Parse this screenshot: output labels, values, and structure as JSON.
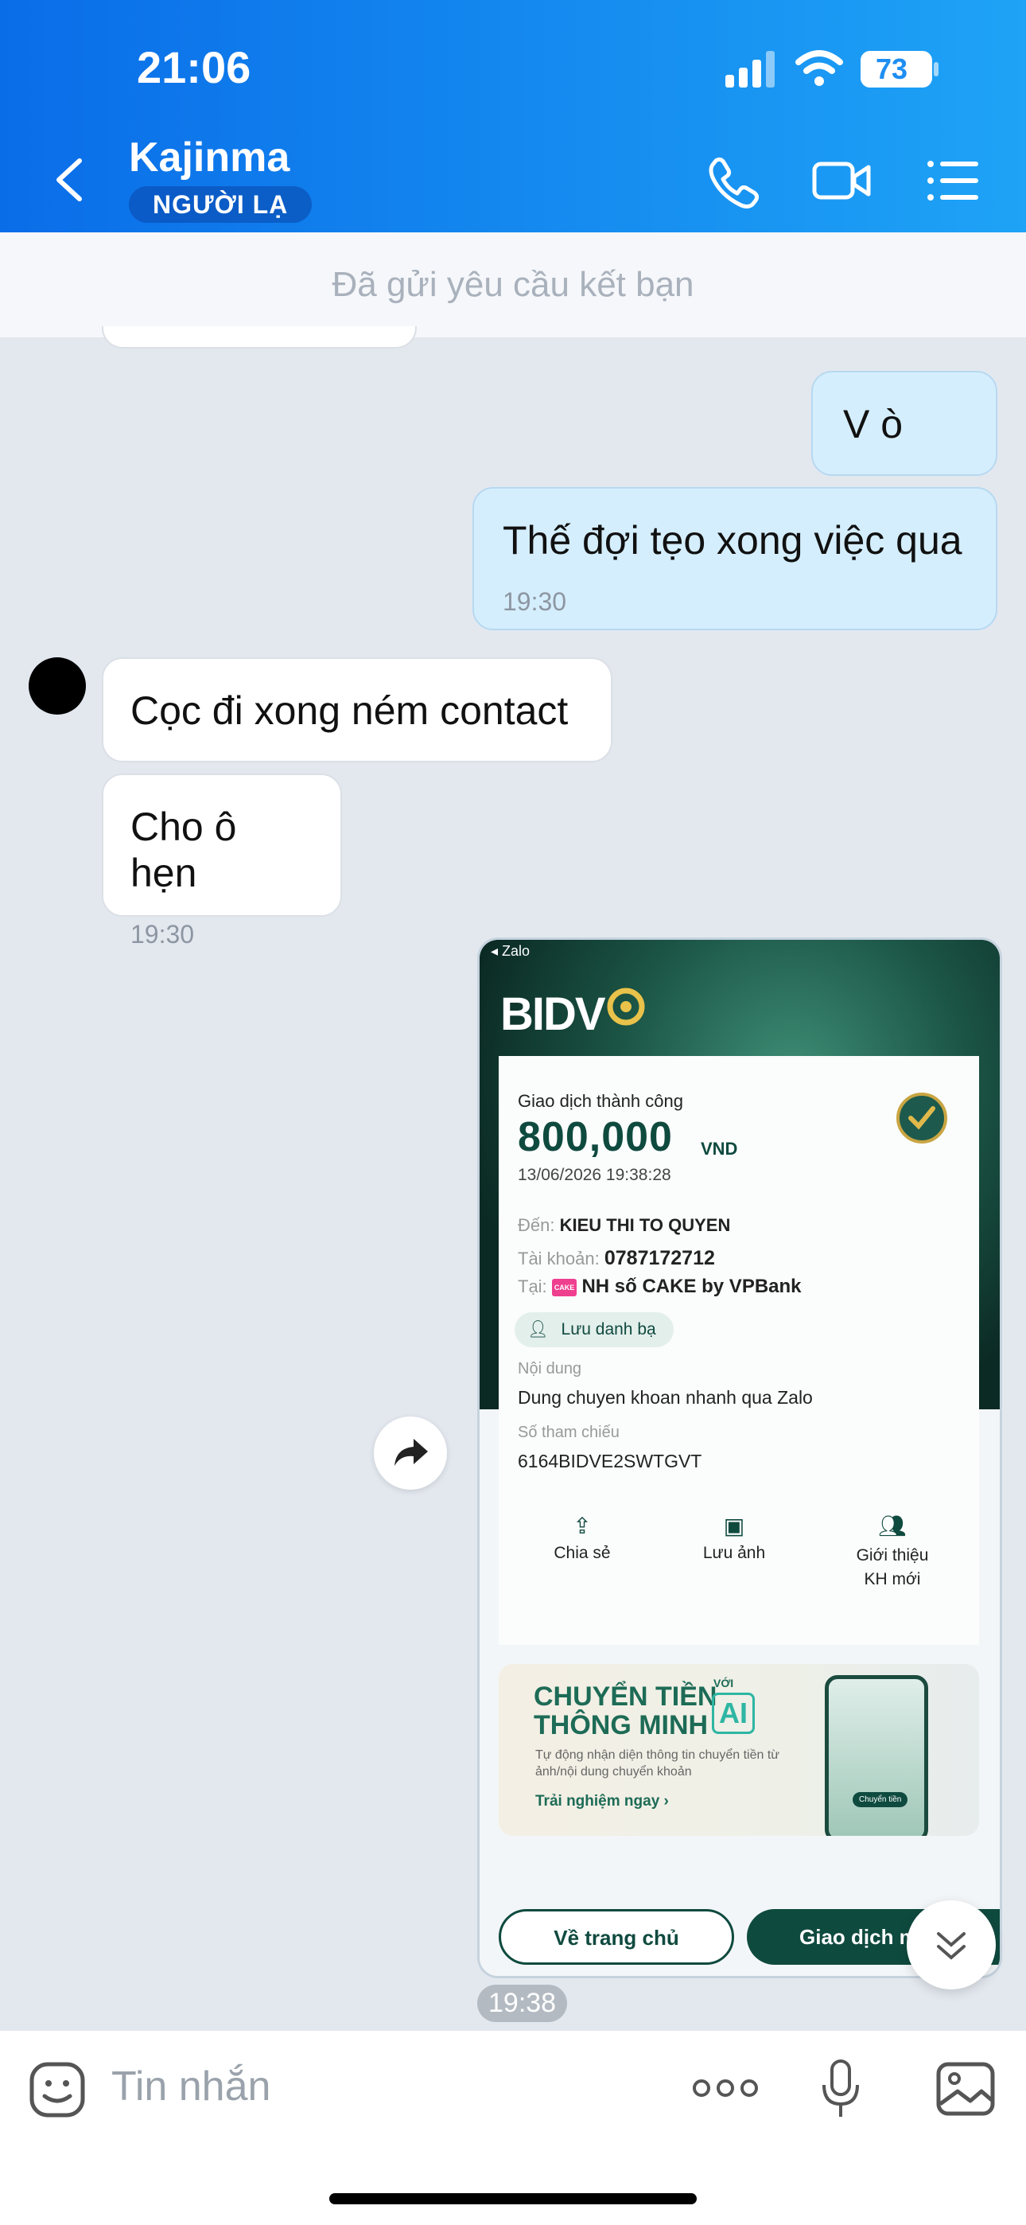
{
  "status_bar": {
    "time": "21:06",
    "battery": "73"
  },
  "header": {
    "contact_name": "Kajinma",
    "badge": "NGƯỜI LẠ"
  },
  "banner": {
    "text": "Đã gửi yêu cầu kết bạn"
  },
  "messages": [
    {
      "side": "me",
      "text": "V ò"
    },
    {
      "side": "me",
      "text": "Thế đợi tẹo xong việc qua",
      "time": "19:30"
    },
    {
      "side": "them",
      "text": "Cọc đi xong ném contact"
    },
    {
      "side": "them",
      "text": "Cho ô hẹn",
      "time": "19:30"
    }
  ],
  "receipt": {
    "back_app": "◂ Zalo",
    "bank_logo": "BIDV",
    "status": "Giao dịch thành công",
    "amount": "800,000",
    "currency": "VND",
    "datetime": "13/06/2026 19:38:28",
    "to_label": "Đến:",
    "to_name": "KIEU THI TO QUYEN",
    "account_label": "Tài khoản:",
    "account_number": "0787172712",
    "bank_label": "Tại:",
    "bank_tag": "CAKE",
    "bank_name": "NH số CAKE by VPBank",
    "save_contact": "Lưu danh bạ",
    "content_label": "Nội dung",
    "content": "Dung chuyen khoan nhanh qua Zalo",
    "ref_label": "Số tham chiếu",
    "ref": "6164BIDVE2SWTGVT",
    "actions": [
      "Chia sẻ",
      "Lưu ảnh",
      "Giới thiệu\nKH mới"
    ],
    "promo_title_1": "CHUYỂN TIỀN",
    "promo_title_2": "THÔNG MINH",
    "promo_with": "VỚI",
    "promo_ai": "AI",
    "promo_desc": "Tự động nhận diện thông tin chuyển tiền từ ảnh/nội dung chuyển khoản",
    "promo_cta": "Trải nghiệm ngay ›",
    "phone_btn": "Chuyển tiền",
    "btn_home": "Về trang chủ",
    "btn_new": "Giao dịch mới"
  },
  "receipt_time": "19:38",
  "input": {
    "placeholder": "Tin nhắn"
  },
  "colors": {
    "header_start": "#0a6de8",
    "header_end": "#1ea3f6",
    "my_bubble": "#d5eefd",
    "bank_green": "#0f4a3f"
  }
}
